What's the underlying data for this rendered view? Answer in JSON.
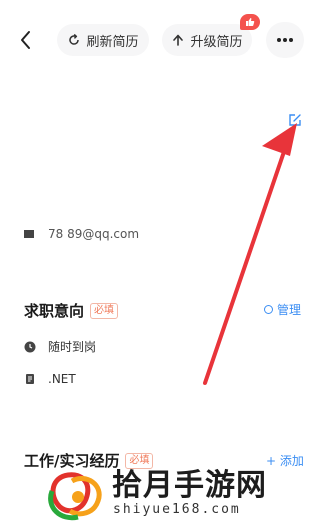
{
  "header": {
    "refresh_label": "刷新简历",
    "upgrade_label": "升级简历"
  },
  "contact": {
    "email_text": "78 89@qq.com"
  },
  "job_intention": {
    "title": "求职意向",
    "required_badge": "必填",
    "manage_label": "管理",
    "availability": "随时到岗",
    "position": ".NET"
  },
  "work_experience": {
    "title": "工作/实习经历",
    "required_badge": "必填",
    "add_label": "+ 添加"
  },
  "watermark": {
    "brand": "拾月手游网",
    "domain": "shiyue168.com"
  },
  "colors": {
    "accent_blue": "#3b8ef3",
    "arrow_red": "#e8343a",
    "badge_red": "#f4524d"
  }
}
